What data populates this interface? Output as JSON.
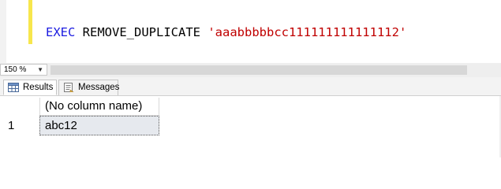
{
  "editor": {
    "keyword": "EXEC",
    "procedure": "REMOVE_DUPLICATE",
    "argument": "'aaabbbbbcc111111111111112'"
  },
  "zoom": {
    "value": "150 %"
  },
  "tabs": [
    {
      "label": "Results",
      "active": true
    },
    {
      "label": "Messages",
      "active": false
    }
  ],
  "grid": {
    "columns": [
      "(No column name)"
    ],
    "rows": [
      {
        "row_number": "1",
        "values": [
          "abc12"
        ]
      }
    ]
  },
  "colors": {
    "keyword": "#1c1ce0",
    "string": "#c00000",
    "change_bar": "#f7e64d",
    "selected_cell": "#e6e9ee"
  }
}
